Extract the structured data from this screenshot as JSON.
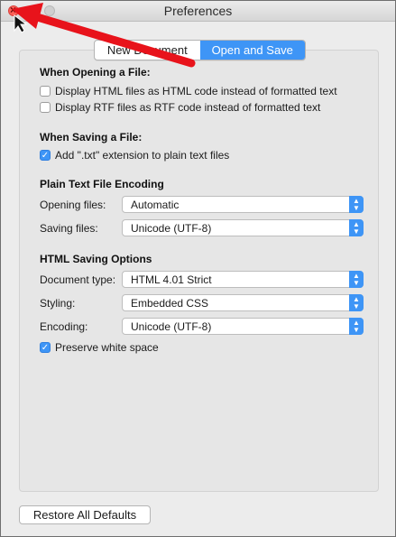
{
  "window": {
    "title": "Preferences"
  },
  "tabs": [
    {
      "label": "New Document",
      "active": false
    },
    {
      "label": "Open and Save",
      "active": true
    }
  ],
  "opening": {
    "heading": "When Opening a File:",
    "options": [
      {
        "label": "Display HTML files as HTML code instead of formatted text",
        "checked": false
      },
      {
        "label": "Display RTF files as RTF code instead of formatted text",
        "checked": false
      }
    ]
  },
  "saving": {
    "heading": "When Saving a File:",
    "options": [
      {
        "label": "Add \".txt\" extension to plain text files",
        "checked": true
      }
    ]
  },
  "encoding": {
    "heading": "Plain Text File Encoding",
    "opening_label": "Opening files:",
    "opening_value": "Automatic",
    "saving_label": "Saving files:",
    "saving_value": "Unicode (UTF-8)"
  },
  "html": {
    "heading": "HTML Saving Options",
    "doctype_label": "Document type:",
    "doctype_value": "HTML 4.01 Strict",
    "styling_label": "Styling:",
    "styling_value": "Embedded CSS",
    "encoding_label": "Encoding:",
    "encoding_value": "Unicode (UTF-8)",
    "preserve_label": "Preserve white space",
    "preserve_checked": true
  },
  "footer": {
    "restore_label": "Restore All Defaults"
  },
  "colors": {
    "accent": "#3e95f6",
    "annotation_arrow": "#e8131b",
    "close_button": "#ff5f57"
  }
}
